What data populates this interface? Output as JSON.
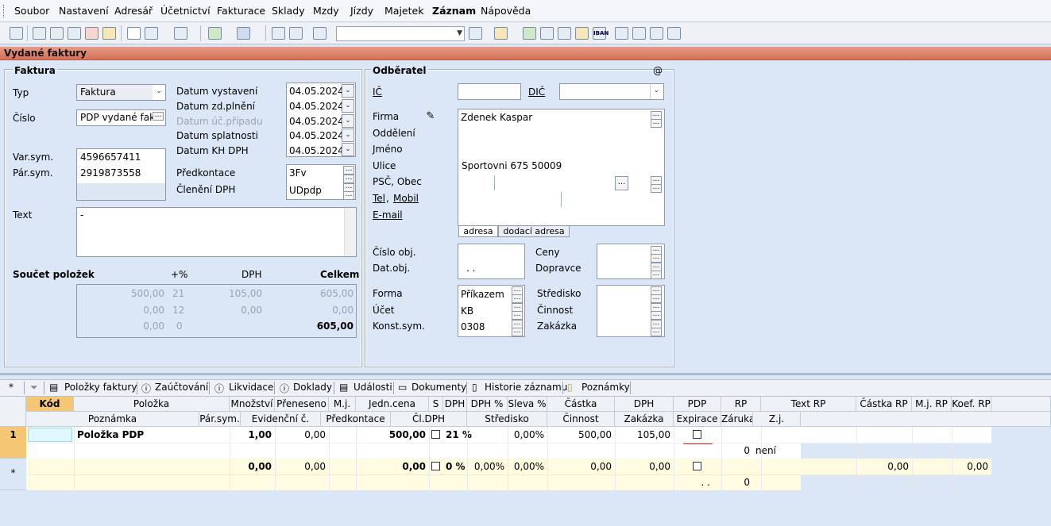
{
  "menu": [
    "Soubor",
    "Nastavení",
    "Adresář",
    "Účetnictví",
    "Fakturace",
    "Sklady",
    "Mzdy",
    "Jízdy",
    "Majetek",
    "Záznam",
    "Nápověda"
  ],
  "window_title": "Vydané faktury",
  "faktura": {
    "section_title": "Faktura",
    "typ_label": "Typ",
    "typ_value": "Faktura",
    "cislo_label": "Číslo",
    "cislo_value": "PDP vydané fakt",
    "varsym_label": "Var.sym.",
    "varsym_value": "4596657411",
    "parsym_label": "Pár.sym.",
    "parsym_value": "2919873558",
    "text_label": "Text",
    "text_value": "-",
    "dates": [
      {
        "label": "Datum vystavení",
        "value": "04.05.2024"
      },
      {
        "label": "Datum zd.plnění",
        "value": "04.05.2024"
      },
      {
        "label": "Datum úč.případu",
        "value": "04.05.2024"
      },
      {
        "label": "Datum splatnosti",
        "value": "04.05.2024"
      },
      {
        "label": "Datum KH DPH",
        "value": "04.05.2024"
      }
    ],
    "predkontace_label": "Předkontace",
    "predkontace_value": "3Fv",
    "cleneni_label": "Členění DPH",
    "cleneni_value": "UDpdp"
  },
  "soucet": {
    "title": "Součet položek",
    "h_pct": "+%",
    "h_dph": "DPH",
    "h_celkem": "Celkem",
    "rows": [
      {
        "base": "500,00",
        "pct": "21",
        "dph": "105,00",
        "total": "605,00"
      },
      {
        "base": "0,00",
        "pct": "12",
        "dph": "0,00",
        "total": "0,00"
      },
      {
        "base": "0,00",
        "pct": "0",
        "total": "605,00"
      }
    ]
  },
  "odberatel": {
    "title": "Odběratel",
    "at": "@",
    "ic_label": "IČ",
    "dic_label": "DIČ",
    "labels": [
      "Firma",
      "Oddělení",
      "Jméno",
      "Ulice",
      "PSČ, Obec"
    ],
    "tel_label": "Tel",
    "tel_comma": ",",
    "mobil_label": "Mobil",
    "email_label": "E-mail",
    "firma_value": "Zdenek Kaspar",
    "ulice_value": "Sportovni 675 50009",
    "ell": "...",
    "tab_adresa": "adresa",
    "tab_dodaci": "dodací adresa",
    "cislo_obj_label": "Číslo obj.",
    "dat_obj_label": "Dat.obj.",
    "dat_obj_value": ". .",
    "ceny_label": "Ceny",
    "dopravce_label": "Dopravce",
    "forma_label": "Forma",
    "forma_value": "Příkazem",
    "ucet_label": "Účet",
    "ucet_value": "KB",
    "konst_label": "Konst.sym.",
    "konst_value": "0308",
    "stredisko_label": "Středisko",
    "cinnost_label": "Činnost",
    "zakazka_label": "Zakázka"
  },
  "tabs": [
    "*",
    "Položky faktury",
    "Zaúčtování",
    "Likvidace",
    "Doklady",
    "Události",
    "Dokumenty",
    "Historie záznamu",
    "Poznámky"
  ],
  "grid": {
    "h1": [
      "Kód",
      "Položka",
      "Množství",
      "Přeneseno",
      "M.j.",
      "Jedn.cena",
      "S",
      "DPH",
      "DPH %",
      "Sleva %",
      "Částka",
      "DPH",
      "PDP",
      "RP",
      "Text RP",
      "Částka RP",
      "M.j. RP",
      "Koef. RP"
    ],
    "h2": [
      "Poznámka",
      "Pár.sym.",
      "Evidenční č.",
      "Předkontace",
      "Čl.DPH",
      "Středisko",
      "Činnost",
      "Zakázka",
      "Expirace",
      "Záruka",
      "Z.j."
    ],
    "row1": {
      "num": "1",
      "polozka": "Položka PDP",
      "mnozstvi": "1,00",
      "preneseno": "0,00",
      "jcena": "500,00",
      "dph": "21 %",
      "dphpct": "0,00%",
      "sleva": "0,00%",
      "castka": "500,00",
      "dphval": "105,00",
      "zaruka": "0",
      "zj": "není"
    },
    "row2": {
      "num": "*",
      "mnozstvi": "0,00",
      "preneseno": "0,00",
      "jcena": "0,00",
      "dph": "0 %",
      "dphpct": "0,00%",
      "sleva": "0,00%",
      "castka": "0,00",
      "dphval": "0,00",
      "castka_rp": "0,00",
      "koef_rp": "0,00",
      "exp": ". .",
      "zaruka": "0"
    }
  }
}
